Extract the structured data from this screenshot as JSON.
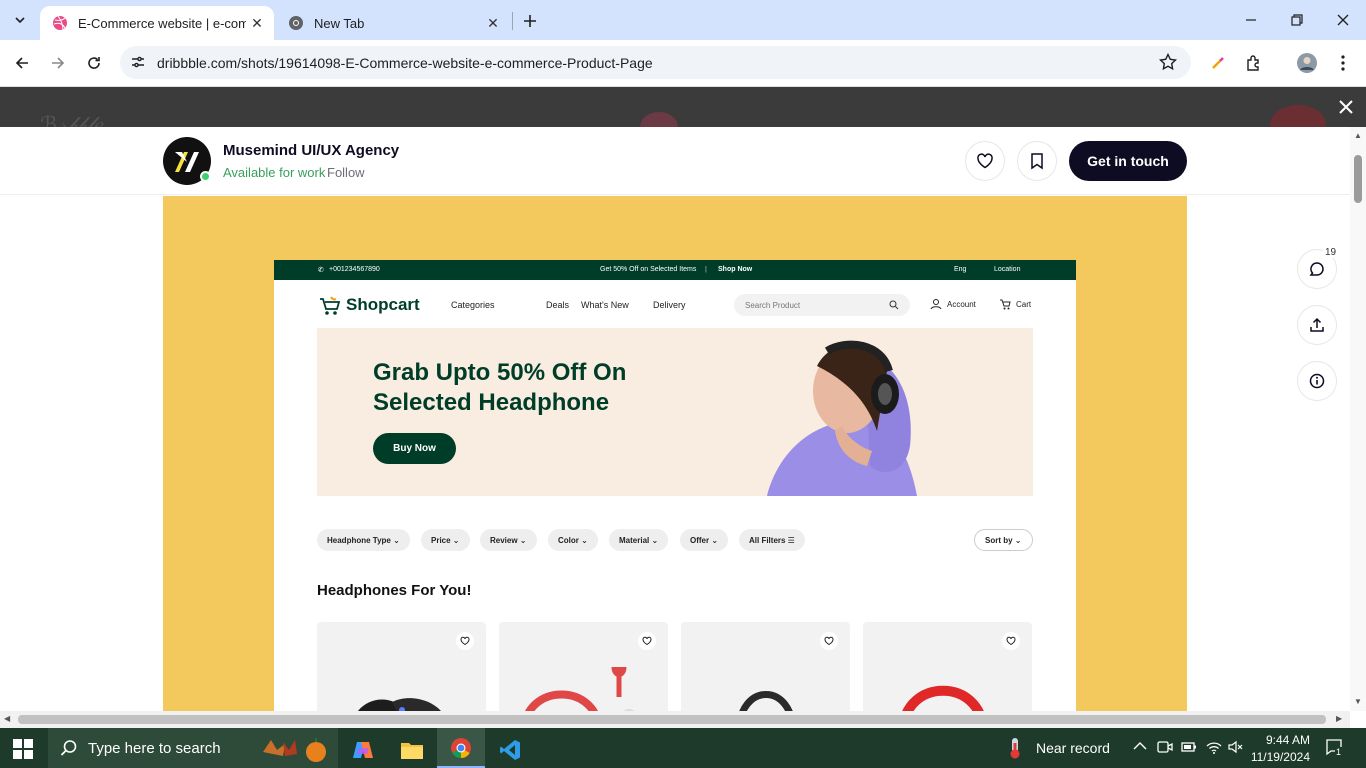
{
  "browser": {
    "tabs": [
      {
        "title": "E-Commerce website | e-comm",
        "active": true
      },
      {
        "title": "New Tab",
        "active": false
      }
    ],
    "url": "dribbble.com/shots/19614098-E-Commerce-website-e-commerce-Product-Page"
  },
  "header": {
    "agency_name": "Musemind UI/UX Agency",
    "availability": "Available for work",
    "follow_label": "Follow",
    "cta_label": "Get in touch"
  },
  "sidebar": {
    "comment_count": "19"
  },
  "shot": {
    "topbar": {
      "phone": "+001234567890",
      "promo": "Get 50% Off on Selected Items",
      "shop_now": "Shop Now",
      "lang": "Eng",
      "location": "Location"
    },
    "brand": "Shopcart",
    "nav": [
      "Categories",
      "Deals",
      "What's New",
      "Delivery"
    ],
    "search_placeholder": "Search Product",
    "account": "Account",
    "cart": "Cart",
    "hero_title": "Grab Upto 50% Off On Selected Headphone",
    "hero_button": "Buy Now",
    "filters": [
      "Headphone Type",
      "Price",
      "Review",
      "Color",
      "Material",
      "Offer",
      "All Filters"
    ],
    "sort_label": "Sort by",
    "section_title": "Headphones For You!"
  },
  "taskbar": {
    "search_placeholder": "Type here to search",
    "weather": "Near record",
    "time": "9:44 AM",
    "date": "11/19/2024",
    "notifications": "1"
  },
  "colors": {
    "accent_green": "#003d29",
    "shot_bg": "#f3c95e",
    "dribbble_pink": "#ea4c89"
  }
}
